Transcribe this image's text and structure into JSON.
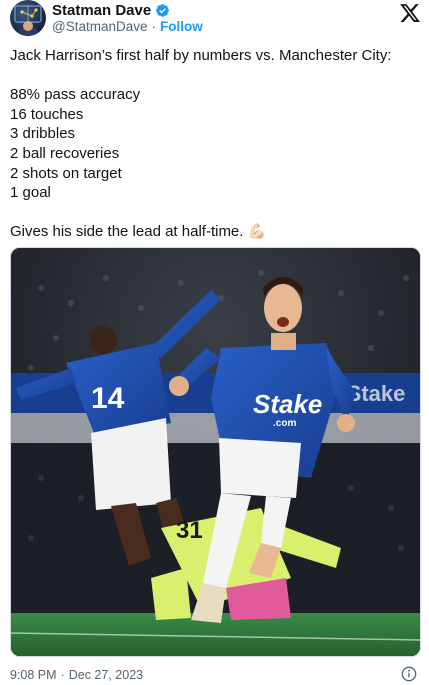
{
  "author": {
    "name": "Statman Dave",
    "handle": "@StatmanDave",
    "follow_label": "Follow",
    "separator": "·",
    "verified_icon": "verified-badge-icon",
    "avatar_icon": "avatar"
  },
  "tweet": {
    "intro": "Jack Harrison’s first half by numbers vs. Manchester City:",
    "stats": [
      "88% pass accuracy",
      "16 touches",
      "3 dribbles",
      "2 ball recoveries",
      "2 shots on target",
      "1 goal"
    ],
    "closing": "Gives his side the lead at half-time. 💪🏻"
  },
  "photo": {
    "jersey_number": "14",
    "keeper_number": "31",
    "sponsor_text": "Stake",
    "sponsor_sub": ".com",
    "board_text": "Stake"
  },
  "footer": {
    "time": "9:08 PM",
    "separator": "·",
    "date": "Dec 27, 2023"
  },
  "colors": {
    "accent": "#1d9bf0",
    "everton_blue": "#1f4fb0",
    "pitch": "#2f7a3a",
    "secondary_text": "#536471"
  }
}
